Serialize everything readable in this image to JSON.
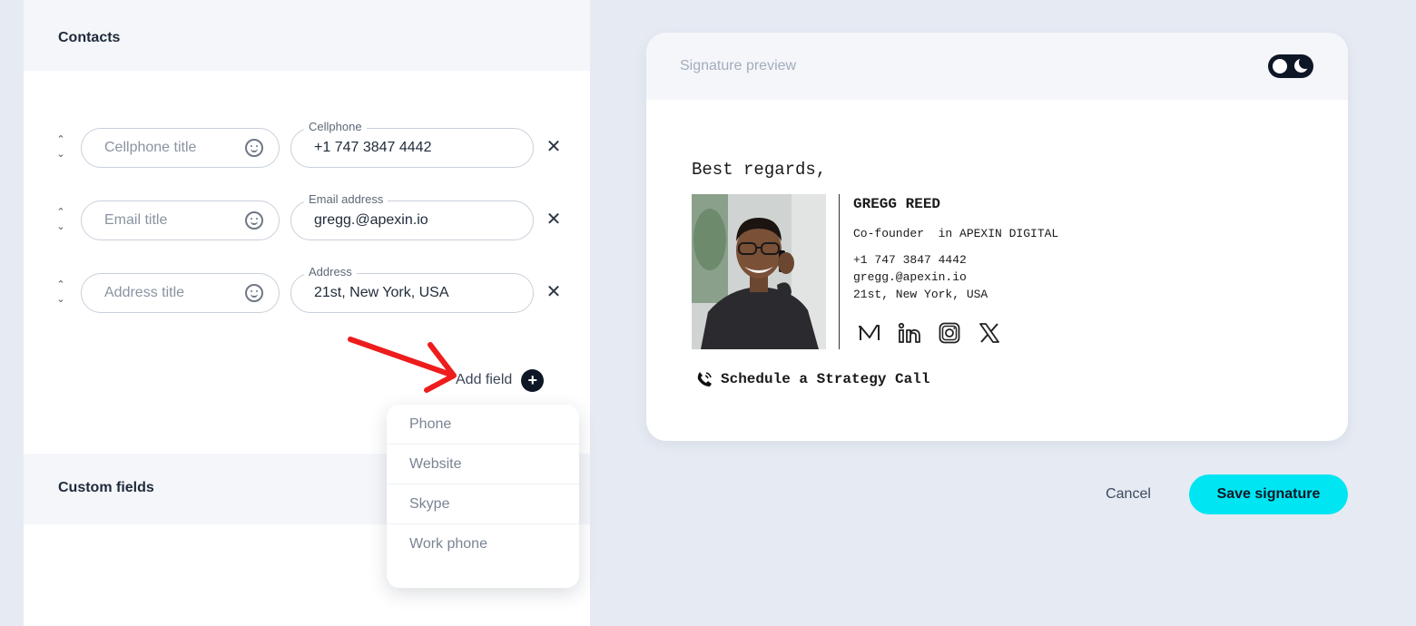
{
  "contacts": {
    "title": "Contacts",
    "rows": [
      {
        "title_placeholder": "Cellphone title",
        "value_label": "Cellphone",
        "value": "+1 747 3847 4442"
      },
      {
        "title_placeholder": "Email title",
        "value_label": "Email address",
        "value": "gregg.@apexin.io"
      },
      {
        "title_placeholder": "Address title",
        "value_label": "Address",
        "value": "21st, New York, USA"
      }
    ],
    "add_field_label": "Add field",
    "add_field_options": [
      "Phone",
      "Website",
      "Skype",
      "Work phone"
    ]
  },
  "custom_fields": {
    "title": "Custom fields"
  },
  "preview": {
    "title": "Signature preview",
    "greeting": "Best regards,",
    "name": "GREGG REED",
    "role": "Co-founder  in APEXIN DIGITAL",
    "phone": "+1 747 3847 4442",
    "email": "gregg.@apexin.io",
    "address": "21st, New York, USA",
    "social_icons": [
      "medium-icon",
      "linkedin-icon",
      "instagram-icon",
      "x-icon"
    ],
    "cta": "Schedule a Strategy Call"
  },
  "actions": {
    "cancel": "Cancel",
    "save": "Save signature"
  },
  "colors": {
    "accent": "#00e5f2",
    "dark": "#0e1726",
    "arrow": "#ee1c1c",
    "background": "#e6ebf3"
  }
}
